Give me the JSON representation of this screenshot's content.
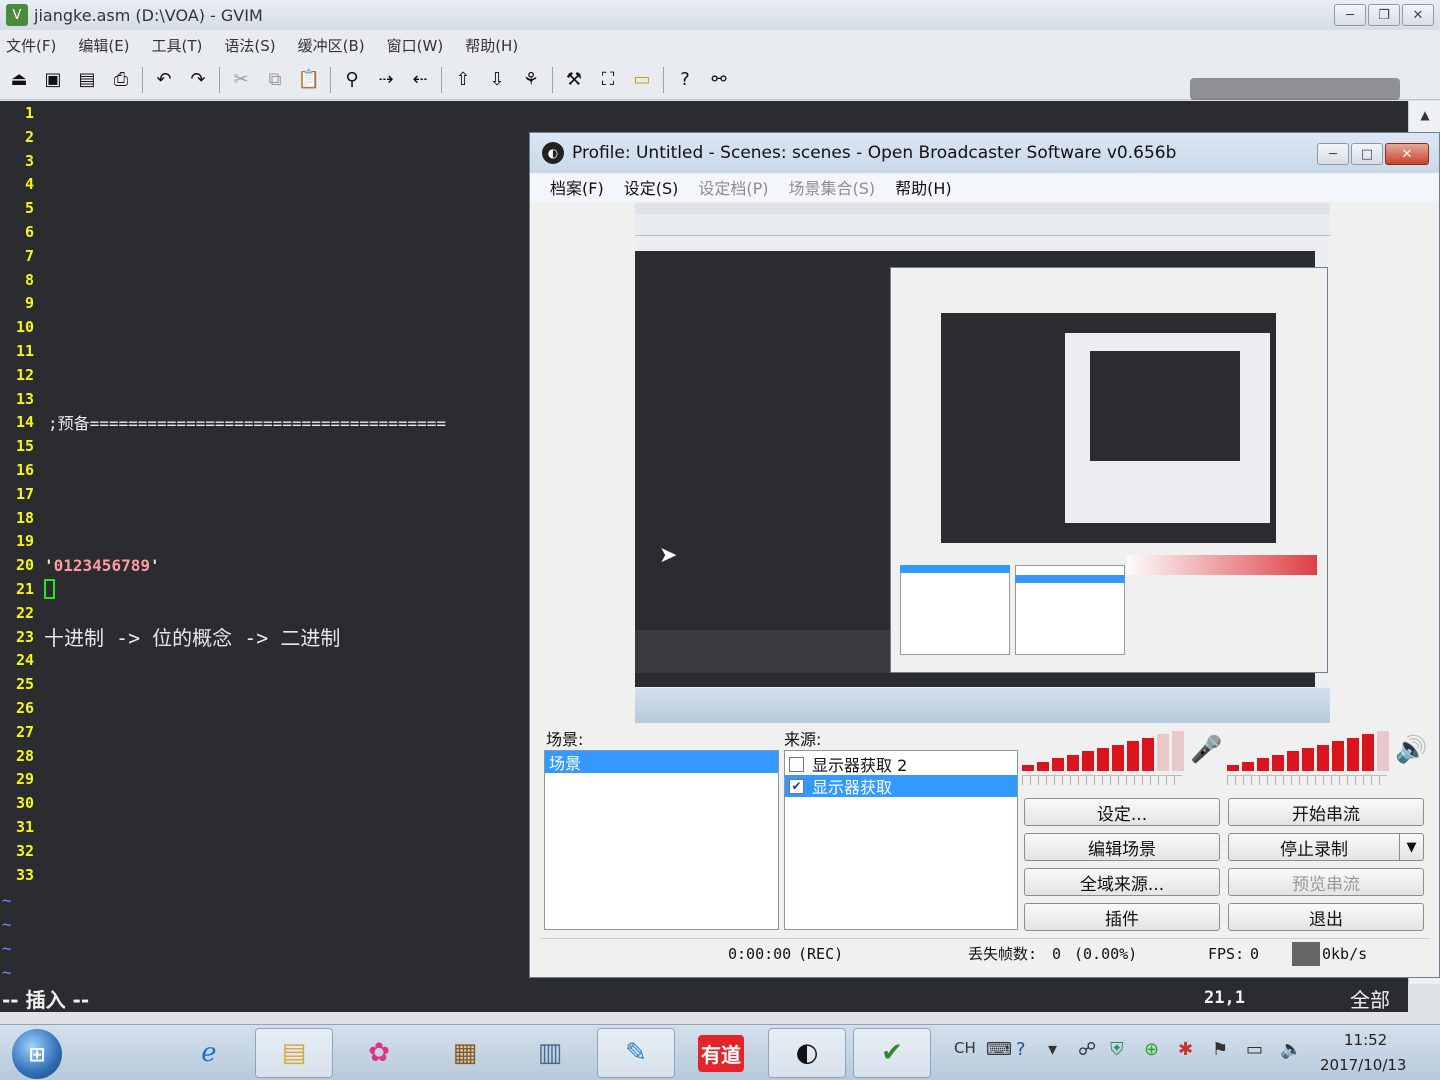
{
  "gvim": {
    "title": "jiangke.asm (D:\\VOA) - GVIM",
    "menu": [
      "文件(F)",
      "编辑(E)",
      "工具(T)",
      "语法(S)",
      "缓冲区(B)",
      "窗口(W)",
      "帮助(H)"
    ],
    "toolbar_icons": [
      "open-icon",
      "save-icon",
      "save-all-icon",
      "print-icon",
      "undo-icon",
      "redo-icon",
      "cut-icon",
      "copy-icon",
      "paste-icon",
      "find-replace-icon",
      "find-next-icon",
      "find-prev-icon",
      "load-session-icon",
      "save-session-icon",
      "run-script-icon",
      "make-icon",
      "shell-icon",
      "tags-icon",
      "help-icon",
      "find-help-icon"
    ],
    "line_numbers": [
      "1",
      "2",
      "3",
      "4",
      "5",
      "6",
      "7",
      "8",
      "9",
      "10",
      "11",
      "12",
      "13",
      "14",
      "15",
      "16",
      "17",
      "18",
      "19",
      "20",
      "21",
      "22",
      "23",
      "24",
      "25",
      "26",
      "27",
      "28",
      "29",
      "30",
      "31",
      "32",
      "33"
    ],
    "lines": {
      "l14": ";预备=====================================",
      "l20_quote_open": "'",
      "l20_string": "0123456789",
      "l20_quote_close": "'",
      "l23": "十进制 -> 位的概念 -> 二进制"
    },
    "tildes": [
      "~",
      "~",
      "~",
      "~"
    ],
    "status": {
      "mode": "-- 插入 --",
      "position": "21,1",
      "scroll": "全部"
    }
  },
  "obs": {
    "title": "Profile: Untitled - Scenes: scenes - Open Broadcaster Software v0.656b",
    "menu": [
      {
        "label": "档案(F)",
        "enabled": true
      },
      {
        "label": "设定(S)",
        "enabled": true
      },
      {
        "label": "设定档(P)",
        "enabled": false
      },
      {
        "label": "场景集合(S)",
        "enabled": false
      },
      {
        "label": "帮助(H)",
        "enabled": true
      }
    ],
    "scenes_label": "场景:",
    "sources_label": "来源:",
    "scenes": [
      {
        "label": "场景",
        "selected": true
      }
    ],
    "sources": [
      {
        "label": "显示器获取 2",
        "checked": false,
        "selected": false
      },
      {
        "label": "显示器获取",
        "checked": true,
        "selected": true
      }
    ],
    "meters": {
      "mic_level": 0.85,
      "desktop_level": 0.9,
      "mic_icon": "microphone-icon",
      "desktop_icon": "speaker-icon"
    },
    "buttons": {
      "settings": "设定...",
      "start_stream": "开始串流",
      "edit_scene": "编辑场景",
      "stop_recording": "停止录制",
      "global_sources": "全域来源...",
      "preview_stream": "预览串流",
      "plugins": "插件",
      "exit": "退出"
    },
    "status": {
      "time": "0:00:00",
      "rec": "(REC)",
      "dropped_label": "丢失帧数:",
      "dropped_value": "0",
      "dropped_pct": "(0.00%)",
      "fps_label": "FPS:",
      "fps_value": "0",
      "bitrate": "0kb/s"
    }
  },
  "taskbar": {
    "start_icon": "windows-start-icon",
    "apps": [
      "internet-explorer-icon",
      "file-explorer-icon",
      "color-picker-icon",
      "dosbox-icon",
      "calculator-icon",
      "paint-icon",
      "youdao-icon",
      "obs-icon",
      "gvim-icon"
    ],
    "youdao_label": "有道",
    "lang": "CH",
    "time": "11:52",
    "date": "2017/10/13"
  }
}
